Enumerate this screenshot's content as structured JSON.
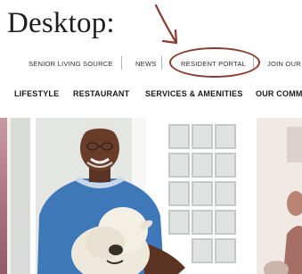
{
  "heading": "Desktop:",
  "utility_nav": {
    "items": [
      "SENIOR LIVING SOURCE",
      "NEWS",
      "RESIDENT PORTAL",
      "JOIN OUR"
    ]
  },
  "main_nav": {
    "items": [
      "LIFESTYLE",
      "RESTAURANT",
      "SERVICES & AMENITIES",
      "OUR COMM"
    ]
  },
  "annotation": {
    "color": "#8b3a2e",
    "highlighted_item": "RESIDENT PORTAL"
  },
  "colors": {
    "text": "#222222",
    "annotation": "#8b3a2e",
    "separator": "#b5b5b5"
  },
  "icons": [
    "annotation-arrow",
    "annotation-oval"
  ]
}
